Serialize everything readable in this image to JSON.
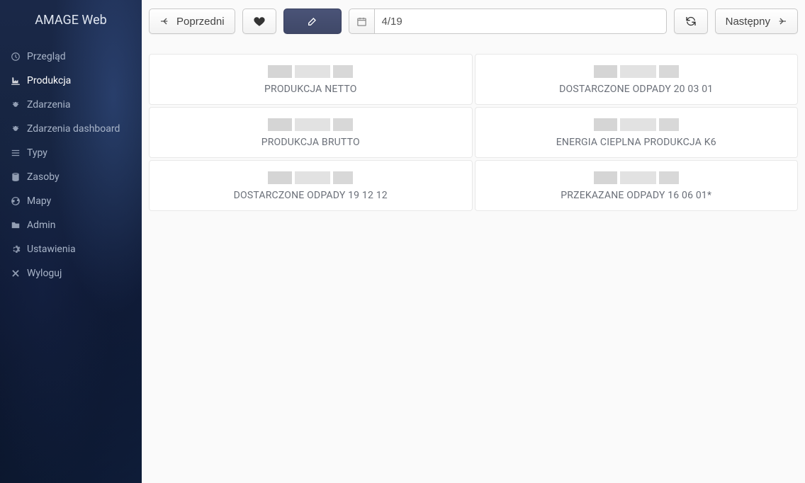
{
  "app_title": "AMAGE Web",
  "sidebar": {
    "items": [
      {
        "label": "Przegląd",
        "icon": "dashboard-icon"
      },
      {
        "label": "Produkcja",
        "icon": "industry-icon",
        "active": true
      },
      {
        "label": "Zdarzenia",
        "icon": "bug-icon"
      },
      {
        "label": "Zdarzenia dashboard",
        "icon": "bug-icon"
      },
      {
        "label": "Typy",
        "icon": "list-icon"
      },
      {
        "label": "Zasoby",
        "icon": "database-icon"
      },
      {
        "label": "Mapy",
        "icon": "globe-icon"
      },
      {
        "label": "Admin",
        "icon": "folder-icon"
      },
      {
        "label": "Ustawienia",
        "icon": "gear-icon"
      },
      {
        "label": "Wyloguj",
        "icon": "close-icon"
      }
    ]
  },
  "toolbar": {
    "previous_label": "Poprzedni",
    "next_label": "Następny",
    "date_value": "4/19"
  },
  "cards": [
    {
      "label": "PRODUKCJA NETTO"
    },
    {
      "label": "DOSTARCZONE ODPADY 20 03 01"
    },
    {
      "label": "PRODUKCJA BRUTTO"
    },
    {
      "label": "ENERGIA CIEPLNA PRODUKCJA K6"
    },
    {
      "label": "DOSTARCZONE ODPADY 19 12 12"
    },
    {
      "label": "PRZEKAZANE ODPADY 16 06 01*"
    }
  ]
}
